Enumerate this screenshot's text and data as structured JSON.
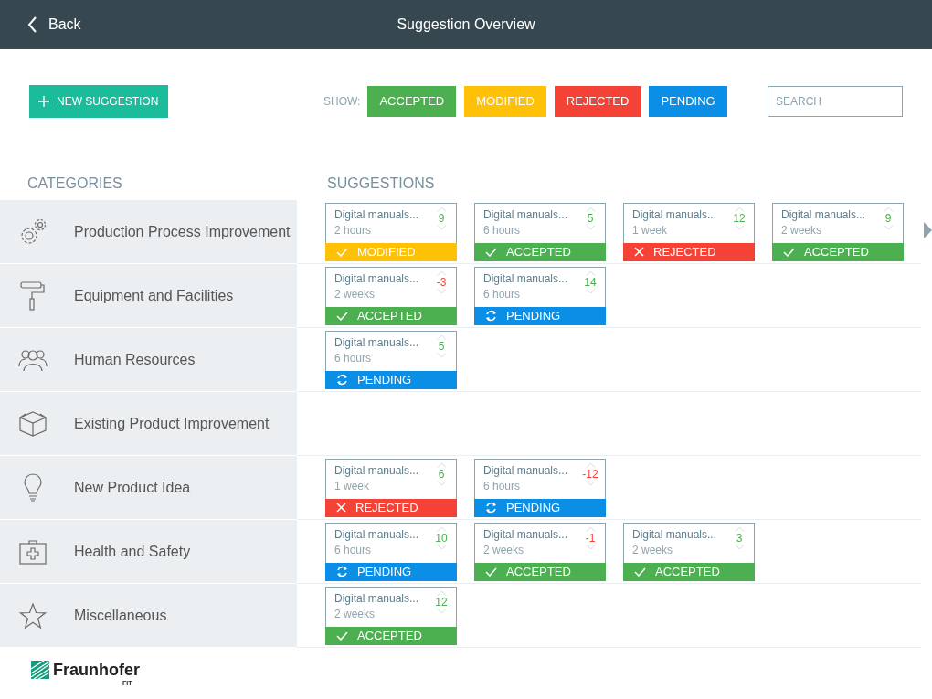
{
  "header": {
    "back": "Back",
    "title": "Suggestion Overview"
  },
  "toolbar": {
    "new_button": "NEW SUGGESTION",
    "show_label": "SHOW:",
    "filters": [
      {
        "label": "ACCEPTED",
        "kind": "accepted"
      },
      {
        "label": "MODIFIED",
        "kind": "modified"
      },
      {
        "label": "REJECTED",
        "kind": "rejected"
      },
      {
        "label": "PENDING",
        "kind": "pending"
      }
    ],
    "search": {
      "placeholder": "SEARCH"
    }
  },
  "categories_heading": "CATEGORIES",
  "suggestions_heading": "SUGGESTIONS",
  "rows": [
    {
      "category": "Production Process Improvement",
      "more": true,
      "suggestions": [
        {
          "title": "Digital manuals...",
          "age": "2 hours",
          "score": "9",
          "negative": false,
          "kind": "modified",
          "label": "MODIFIED"
        },
        {
          "title": "Digital manuals...",
          "age": "6 hours",
          "score": "5",
          "negative": false,
          "kind": "accepted",
          "label": "ACCEPTED"
        },
        {
          "title": "Digital manuals...",
          "age": "1 week",
          "score": "12",
          "negative": false,
          "kind": "rejected",
          "label": "REJECTED"
        },
        {
          "title": "Digital manuals...",
          "age": "2 weeks",
          "score": "9",
          "negative": false,
          "kind": "accepted",
          "label": "ACCEPTED"
        }
      ]
    },
    {
      "category": "Equipment and Facilities",
      "more": false,
      "suggestions": [
        {
          "title": "Digital manuals...",
          "age": "2 weeks",
          "score": "-3",
          "negative": true,
          "kind": "accepted",
          "label": "ACCEPTED"
        },
        {
          "title": "Digital manuals...",
          "age": "6 hours",
          "score": "14",
          "negative": false,
          "kind": "pending",
          "label": "PENDING"
        }
      ]
    },
    {
      "category": "Human Resources",
      "more": false,
      "suggestions": [
        {
          "title": "Digital manuals...",
          "age": "6 hours",
          "score": "5",
          "negative": false,
          "kind": "pending",
          "label": "PENDING"
        }
      ]
    },
    {
      "category": "Existing Product Improvement",
      "more": false,
      "suggestions": []
    },
    {
      "category": "New Product Idea",
      "more": false,
      "suggestions": [
        {
          "title": "Digital manuals...",
          "age": "1 week",
          "score": "6",
          "negative": false,
          "kind": "rejected",
          "label": "REJECTED"
        },
        {
          "title": "Digital manuals...",
          "age": "6 hours",
          "score": "-12",
          "negative": true,
          "kind": "pending",
          "label": "PENDING"
        }
      ]
    },
    {
      "category": "Health and Safety",
      "more": false,
      "suggestions": [
        {
          "title": "Digital manuals...",
          "age": "6 hours",
          "score": "10",
          "negative": false,
          "kind": "pending",
          "label": "PENDING"
        },
        {
          "title": "Digital manuals...",
          "age": "2 weeks",
          "score": "-1",
          "negative": true,
          "kind": "accepted",
          "label": "ACCEPTED"
        },
        {
          "title": "Digital manuals...",
          "age": "2 weeks",
          "score": "3",
          "negative": false,
          "kind": "accepted",
          "label": "ACCEPTED"
        }
      ]
    },
    {
      "category": "Miscellaneous",
      "more": false,
      "suggestions": [
        {
          "title": "Digital manuals...",
          "age": "2 weeks",
          "score": "12",
          "negative": false,
          "kind": "accepted",
          "label": "ACCEPTED"
        }
      ]
    }
  ],
  "footer": {
    "logo": "Fraunhofer",
    "sublabel": "FIT"
  }
}
